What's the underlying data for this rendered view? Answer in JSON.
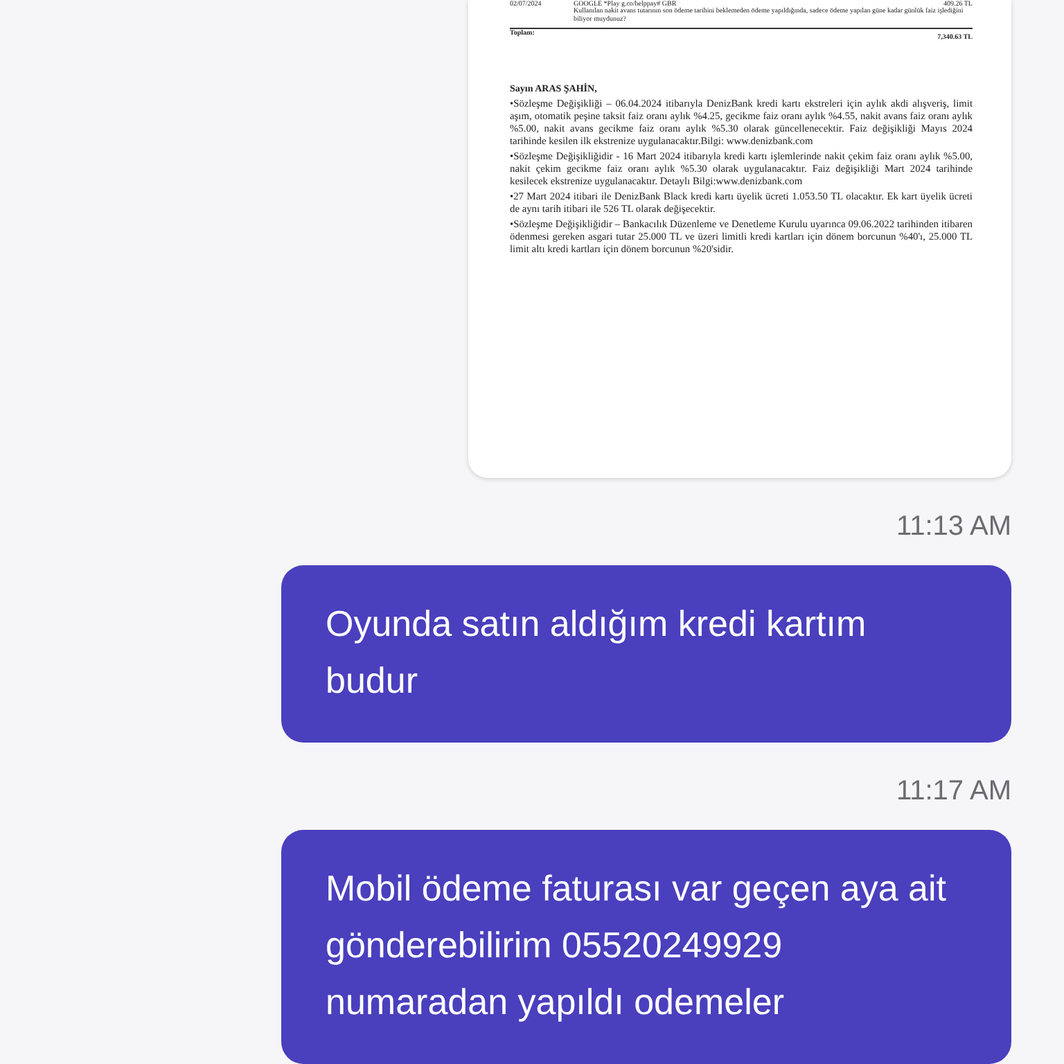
{
  "messages": [
    {
      "kind": "document",
      "statement": {
        "rows": [
          {
            "date": "02/07/2024",
            "description": "GOOGLE *Play g.co/helppay# GBR",
            "amount": "409.26 TL",
            "note": "Kullanılan nakit avans tutarının son ödeme tarihini beklemeden ödeme yapıldığında, sadece ödeme yapılan güne kadar günlük faiz işlediğini biliyor muydunuz?"
          }
        ],
        "total_label": "Toplam:",
        "total": "7,340.63 TL",
        "greeting": "Sayın ARAS  ŞAHİN,",
        "paragraphs": [
          "•Sözleşme Değişikliği – 06.04.2024 itibarıyla DenizBank kredi kartı ekstreleri için aylık akdi alışveriş, limit aşım, otomatik peşine taksit faiz oranı aylık %4.25, gecikme faiz oranı aylık %4.55, nakit avans faiz oranı aylık %5.00, nakit avans gecikme faiz oranı aylık %5.30 olarak güncellenecektir. Faiz değişikliği Mayıs 2024 tarihinde kesilen ilk ekstrenize uygulanacaktır.Bilgi: www.denizbank.com",
          "•Sözleşme Değişikliğidir - 16 Mart 2024 itibarıyla kredi kartı işlemlerinde nakit çekim faiz oranı aylık %5.00, nakit çekim gecikme faiz oranı aylık %5.30 olarak uygulanacaktır. Faiz değişikliği Mart 2024 tarihinde kesilecek ekstrenize uygulanacaktır. Detaylı Bilgi:www.denizbank.com",
          "•27 Mart 2024 itibari ile DenizBank Black kredi kartı üyelik ücreti 1.053.50 TL olacaktır. Ek kart üyelik ücreti de aynı tarih itibari ile 526 TL olarak değişecektir.",
          "•Sözleşme Değişikliğidir – Bankacılık Düzenleme ve Denetleme Kurulu uyarınca 09.06.2022 tarihinden itibaren ödenmesi gereken asgari tutar 25.000 TL ve üzeri limitli kredi kartları için dönem borcunun %40'ı, 25.000 TL limit altı kredi kartları için dönem borcunun %20'sidir."
        ]
      }
    },
    {
      "kind": "time",
      "text": "11:13 AM"
    },
    {
      "kind": "text",
      "text": "Oyunda satın aldığım kredi kartım budur"
    },
    {
      "kind": "time",
      "text": "11:17 AM"
    },
    {
      "kind": "text",
      "text": "Mobil ödeme faturası var geçen aya ait gönderebilirim 05520249929 numaradan yapıldı odemeler"
    }
  ]
}
